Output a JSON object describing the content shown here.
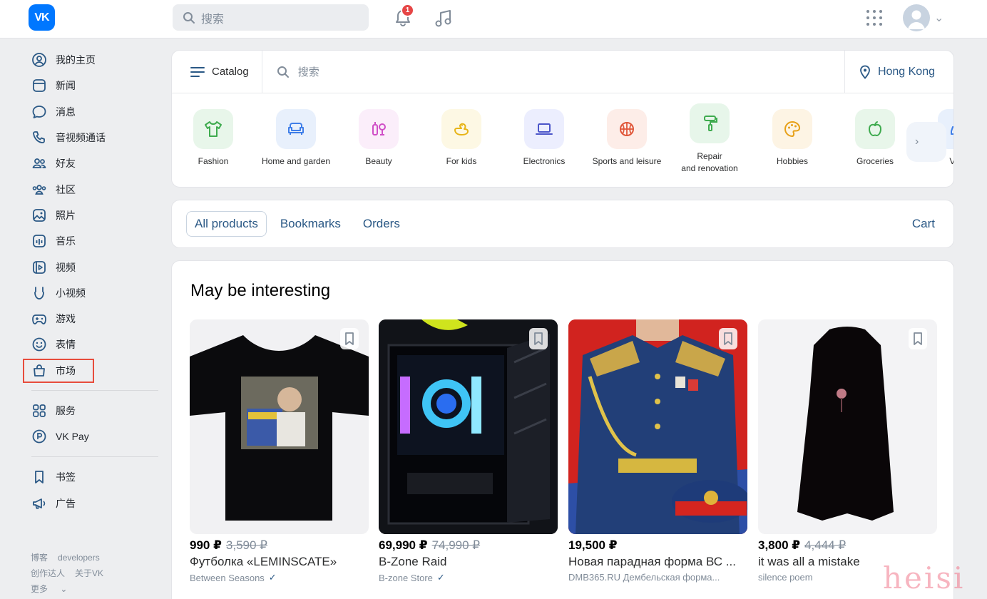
{
  "topbar": {
    "logo_text": "VK",
    "search_placeholder": "搜索",
    "notifications_count": "1"
  },
  "sidebar": {
    "items": [
      {
        "label": "我的主页",
        "icon": "user-circle-icon"
      },
      {
        "label": "新闻",
        "icon": "newspaper-icon"
      },
      {
        "label": "消息",
        "icon": "chat-bubble-icon"
      },
      {
        "label": "音视频通话",
        "icon": "phone-icon"
      },
      {
        "label": "好友",
        "icon": "friends-icon"
      },
      {
        "label": "社区",
        "icon": "community-icon"
      },
      {
        "label": "照片",
        "icon": "photo-icon"
      },
      {
        "label": "音乐",
        "icon": "music-icon"
      },
      {
        "label": "视频",
        "icon": "video-icon"
      },
      {
        "label": "小视频",
        "icon": "clips-icon"
      },
      {
        "label": "游戏",
        "icon": "gamepad-icon"
      },
      {
        "label": "表情",
        "icon": "smile-icon"
      },
      {
        "label": "市场",
        "icon": "shopping-bag-icon"
      }
    ],
    "items2": [
      {
        "label": "服务",
        "icon": "services-grid-icon"
      },
      {
        "label": "VK Pay",
        "icon": "vkpay-icon"
      }
    ],
    "items3": [
      {
        "label": "书签",
        "icon": "bookmark-icon"
      },
      {
        "label": "广告",
        "icon": "megaphone-icon"
      }
    ],
    "footer": {
      "blog": "博客",
      "developers": "developers",
      "creators": "创作达人",
      "about": "关于VK",
      "more": "更多"
    }
  },
  "catalog": {
    "button_label": "Catalog",
    "search_placeholder": "搜索",
    "location": "Hong Kong",
    "categories": [
      {
        "label": "Fashion",
        "color": "#e8f6ea",
        "icon": "tshirt-icon"
      },
      {
        "label": "Home and garden",
        "color": "#e8f0fc",
        "icon": "sofa-icon"
      },
      {
        "label": "Beauty",
        "color": "#fbeefa",
        "icon": "cosmetics-icon"
      },
      {
        "label": "For kids",
        "color": "#fdf8e4",
        "icon": "duck-icon"
      },
      {
        "label": "Electronics",
        "color": "#eceefe",
        "icon": "laptop-icon"
      },
      {
        "label": "Sports and leisure",
        "color": "#fdede8",
        "icon": "basketball-icon"
      },
      {
        "label": "Repair\nand renovation",
        "color": "#e7f6ea",
        "icon": "paint-roller-icon"
      },
      {
        "label": "Hobbies",
        "color": "#fdf4e4",
        "icon": "palette-icon"
      },
      {
        "label": "Groceries",
        "color": "#e8f6ea",
        "icon": "apple-icon"
      },
      {
        "label": "Vehi",
        "color": "#e8f0fc",
        "icon": "car-icon"
      }
    ]
  },
  "tabs": {
    "all": "All products",
    "bookmarks": "Bookmarks",
    "orders": "Orders",
    "cart": "Cart"
  },
  "products_section": {
    "title": "May be interesting",
    "items": [
      {
        "price": "990 ₽",
        "old_price": "3,590 ₽",
        "name": "Футболка «LEMINSCATE»",
        "shop": "Between Seasons",
        "verified": true,
        "image": "black-tshirt"
      },
      {
        "price": "69,990 ₽",
        "old_price": "74,990 ₽",
        "name": "B-Zone Raid",
        "shop": "B-zone Store",
        "verified": true,
        "image": "pc-case"
      },
      {
        "price": "19,500 ₽",
        "old_price": "",
        "name": "Новая парадная форма ВС ...",
        "shop": "DMB365.RU Дембельская форма...",
        "verified": false,
        "image": "military-uniform"
      },
      {
        "price": "3,800 ₽",
        "old_price": "4,444 ₽",
        "name": "it was all a mistake",
        "shop": "silence poem",
        "verified": false,
        "image": "black-cape"
      }
    ]
  },
  "watermark": "heisi"
}
